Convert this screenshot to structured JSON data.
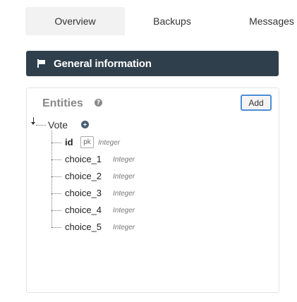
{
  "tabs": [
    {
      "label": "Overview",
      "active": true
    },
    {
      "label": "Backups",
      "active": false
    },
    {
      "label": "Messages",
      "active": false
    }
  ],
  "header": {
    "icon": "flag-icon",
    "title": "General information",
    "background": "#2f3f4b"
  },
  "entities_panel": {
    "title": "Entities",
    "help_icon": "question-circle-icon",
    "add_label": "Add",
    "tree": {
      "entity": "Vote",
      "add_field_icon": "plus-circle-icon",
      "fields": [
        {
          "name": "id",
          "badge": "pk",
          "type": "Integer",
          "primary_key": true
        },
        {
          "name": "choice_1",
          "type": "Integer",
          "primary_key": false
        },
        {
          "name": "choice_2",
          "type": "Integer",
          "primary_key": false
        },
        {
          "name": "choice_3",
          "type": "Integer",
          "primary_key": false
        },
        {
          "name": "choice_4",
          "type": "Integer",
          "primary_key": false
        },
        {
          "name": "choice_5",
          "type": "Integer",
          "primary_key": false
        }
      ]
    }
  },
  "colors": {
    "accent": "#4a8bd6",
    "header_bg": "#2f3f4b",
    "active_tab_bg": "#f2f2f2"
  }
}
